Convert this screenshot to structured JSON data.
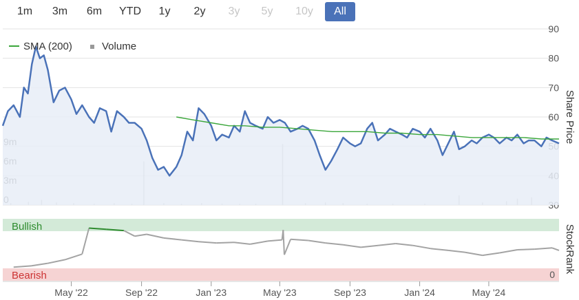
{
  "range_selector": {
    "buttons": [
      {
        "label": "1m",
        "state": "normal"
      },
      {
        "label": "3m",
        "state": "normal"
      },
      {
        "label": "6m",
        "state": "normal"
      },
      {
        "label": "YTD",
        "state": "normal"
      },
      {
        "label": "1y",
        "state": "normal"
      },
      {
        "label": "2y",
        "state": "normal"
      },
      {
        "label": "3y",
        "state": "disabled"
      },
      {
        "label": "5y",
        "state": "disabled"
      },
      {
        "label": "10y",
        "state": "disabled"
      },
      {
        "label": "All",
        "state": "active"
      }
    ]
  },
  "colors": {
    "price": "#4a72b8",
    "sma": "#3aa63a",
    "volume": "#bbbbbb",
    "stockrank": "#a3a3a3",
    "bullish_band": "#d3ead8",
    "bearish_band": "#f6d3d3",
    "bullish_line": "#2e8b2e",
    "bearish_line": "#cc3333",
    "active_button": "#4a72b8"
  },
  "chart_data": [
    {
      "type": "line",
      "legend": [
        "SMA (200)",
        "Volume"
      ],
      "y_label": "Share Price",
      "y_ticks": [
        "90",
        "80",
        "70",
        "60",
        "50",
        "40",
        "30"
      ],
      "y_range": [
        30,
        90
      ],
      "volume_ticks": [
        "9m",
        "6m",
        "3m",
        "0"
      ],
      "volume_range": [
        0,
        12
      ],
      "x_ticks": [
        "May '22",
        "Sep '22",
        "Jan '23",
        "May '23",
        "Sep '23",
        "Jan '24",
        "May '24"
      ],
      "x_range": [
        "2022-01-01",
        "2024-09-01"
      ],
      "series": [
        {
          "name": "Share Price",
          "points": [
            [
              "2022-01-01",
              57
            ],
            [
              "2022-01-10",
              62
            ],
            [
              "2022-01-20",
              64
            ],
            [
              "2022-01-31",
              60
            ],
            [
              "2022-02-07",
              70
            ],
            [
              "2022-02-14",
              68
            ],
            [
              "2022-02-21",
              78
            ],
            [
              "2022-02-28",
              84
            ],
            [
              "2022-03-07",
              80
            ],
            [
              "2022-03-14",
              81
            ],
            [
              "2022-03-21",
              76
            ],
            [
              "2022-03-31",
              65
            ],
            [
              "2022-04-10",
              69
            ],
            [
              "2022-04-20",
              70
            ],
            [
              "2022-05-01",
              66
            ],
            [
              "2022-05-10",
              61
            ],
            [
              "2022-05-20",
              64
            ],
            [
              "2022-06-01",
              60
            ],
            [
              "2022-06-10",
              58
            ],
            [
              "2022-06-20",
              63
            ],
            [
              "2022-07-01",
              62
            ],
            [
              "2022-07-10",
              55
            ],
            [
              "2022-07-20",
              62
            ],
            [
              "2022-08-01",
              60
            ],
            [
              "2022-08-10",
              58
            ],
            [
              "2022-08-20",
              58
            ],
            [
              "2022-09-01",
              56
            ],
            [
              "2022-09-10",
              52
            ],
            [
              "2022-09-20",
              46
            ],
            [
              "2022-09-30",
              42
            ],
            [
              "2022-10-10",
              43
            ],
            [
              "2022-10-20",
              40
            ],
            [
              "2022-11-01",
              43
            ],
            [
              "2022-11-10",
              47
            ],
            [
              "2022-11-20",
              55
            ],
            [
              "2022-11-30",
              52
            ],
            [
              "2022-12-10",
              63
            ],
            [
              "2022-12-20",
              61
            ],
            [
              "2023-01-01",
              57
            ],
            [
              "2023-01-10",
              52
            ],
            [
              "2023-01-20",
              54
            ],
            [
              "2023-02-01",
              53
            ],
            [
              "2023-02-10",
              57
            ],
            [
              "2023-02-20",
              55
            ],
            [
              "2023-03-01",
              62
            ],
            [
              "2023-03-10",
              58
            ],
            [
              "2023-03-20",
              57
            ],
            [
              "2023-04-01",
              56
            ],
            [
              "2023-04-10",
              60
            ],
            [
              "2023-04-20",
              58
            ],
            [
              "2023-05-01",
              59
            ],
            [
              "2023-05-10",
              58
            ],
            [
              "2023-05-20",
              55
            ],
            [
              "2023-06-01",
              56
            ],
            [
              "2023-06-10",
              57
            ],
            [
              "2023-06-20",
              56
            ],
            [
              "2023-07-01",
              52
            ],
            [
              "2023-07-10",
              47
            ],
            [
              "2023-07-20",
              42
            ],
            [
              "2023-07-30",
              45
            ],
            [
              "2023-08-10",
              49
            ],
            [
              "2023-08-20",
              53
            ],
            [
              "2023-09-01",
              51
            ],
            [
              "2023-09-10",
              50
            ],
            [
              "2023-09-20",
              51
            ],
            [
              "2023-10-01",
              56
            ],
            [
              "2023-10-10",
              58
            ],
            [
              "2023-10-20",
              52
            ],
            [
              "2023-11-01",
              54
            ],
            [
              "2023-11-10",
              56
            ],
            [
              "2023-11-20",
              55
            ],
            [
              "2023-12-01",
              54
            ],
            [
              "2023-12-10",
              53
            ],
            [
              "2023-12-20",
              56
            ],
            [
              "2024-01-01",
              55
            ],
            [
              "2024-01-10",
              53
            ],
            [
              "2024-01-20",
              56
            ],
            [
              "2024-02-01",
              52
            ],
            [
              "2024-02-10",
              47
            ],
            [
              "2024-02-20",
              51
            ],
            [
              "2024-03-01",
              55
            ],
            [
              "2024-03-10",
              49
            ],
            [
              "2024-03-20",
              50
            ],
            [
              "2024-04-01",
              52
            ],
            [
              "2024-04-10",
              51
            ],
            [
              "2024-04-20",
              53
            ],
            [
              "2024-05-01",
              54
            ],
            [
              "2024-05-10",
              53
            ],
            [
              "2024-05-20",
              51
            ],
            [
              "2024-06-01",
              53
            ],
            [
              "2024-06-10",
              52
            ],
            [
              "2024-06-20",
              54
            ],
            [
              "2024-07-01",
              51
            ],
            [
              "2024-07-10",
              52
            ],
            [
              "2024-07-20",
              52
            ],
            [
              "2024-08-01",
              50
            ],
            [
              "2024-08-10",
              53
            ],
            [
              "2024-08-20",
              52
            ],
            [
              "2024-09-01",
              51
            ]
          ]
        },
        {
          "name": "SMA (200)",
          "points": [
            [
              "2022-11-01",
              60
            ],
            [
              "2022-12-01",
              59
            ],
            [
              "2023-01-01",
              58
            ],
            [
              "2023-02-01",
              57
            ],
            [
              "2023-03-01",
              57
            ],
            [
              "2023-04-01",
              56.5
            ],
            [
              "2023-05-01",
              56.5
            ],
            [
              "2023-06-01",
              56
            ],
            [
              "2023-07-01",
              55.5
            ],
            [
              "2023-08-01",
              55
            ],
            [
              "2023-09-01",
              55
            ],
            [
              "2023-10-01",
              55
            ],
            [
              "2023-11-01",
              54.5
            ],
            [
              "2023-12-01",
              54.5
            ],
            [
              "2024-01-01",
              54
            ],
            [
              "2024-02-01",
              54
            ],
            [
              "2024-03-01",
              53.5
            ],
            [
              "2024-04-01",
              53
            ],
            [
              "2024-05-01",
              53
            ],
            [
              "2024-06-01",
              53
            ],
            [
              "2024-07-01",
              53
            ],
            [
              "2024-08-01",
              52.5
            ],
            [
              "2024-09-01",
              52.5
            ]
          ]
        },
        {
          "name": "Volume",
          "points": [
            [
              "2022-01-15",
              0.3
            ],
            [
              "2022-02-15",
              0.5
            ],
            [
              "2022-03-10",
              0.8
            ],
            [
              "2022-04-05",
              0.4
            ],
            [
              "2022-05-05",
              0.3
            ],
            [
              "2022-06-10",
              0.2
            ],
            [
              "2022-07-15",
              0.3
            ],
            [
              "2022-08-15",
              0.2
            ],
            [
              "2022-09-05",
              6.8
            ],
            [
              "2022-10-10",
              0.3
            ],
            [
              "2022-11-10",
              0.2
            ],
            [
              "2022-12-15",
              0.3
            ],
            [
              "2023-01-20",
              0.2
            ],
            [
              "2023-02-20",
              0.2
            ],
            [
              "2023-03-20",
              0.2
            ],
            [
              "2023-05-06",
              9.5
            ],
            [
              "2023-06-15",
              0.3
            ],
            [
              "2023-07-20",
              0.4
            ],
            [
              "2023-08-20",
              0.3
            ],
            [
              "2023-10-01",
              0.2
            ],
            [
              "2023-11-15",
              0.2
            ],
            [
              "2024-01-10",
              0.2
            ],
            [
              "2024-03-10",
              1.5
            ],
            [
              "2024-04-20",
              0.4
            ],
            [
              "2024-06-01",
              0.6
            ],
            [
              "2024-06-20",
              1.0
            ],
            [
              "2024-07-15",
              1.2
            ]
          ]
        }
      ]
    },
    {
      "type": "line",
      "y_label": "StockRank",
      "y_ticks": [
        "0"
      ],
      "y_range": [
        0,
        100
      ],
      "bands": [
        {
          "label": "Bullish",
          "from": 80,
          "to": 100
        },
        {
          "label": "Bearish",
          "from": 0,
          "to": 20
        }
      ],
      "series": [
        {
          "name": "StockRank",
          "points": [
            [
              "2022-01-20",
              22
            ],
            [
              "2022-02-20",
              24
            ],
            [
              "2022-03-20",
              28
            ],
            [
              "2022-04-20",
              34
            ],
            [
              "2022-05-20",
              43
            ],
            [
              "2022-06-01",
              85
            ],
            [
              "2022-07-01",
              83
            ],
            [
              "2022-08-01",
              81
            ],
            [
              "2022-08-20",
              72
            ],
            [
              "2022-09-10",
              75
            ],
            [
              "2022-10-10",
              69
            ],
            [
              "2022-11-10",
              66
            ],
            [
              "2022-12-10",
              63
            ],
            [
              "2023-01-10",
              61
            ],
            [
              "2023-02-10",
              62
            ],
            [
              "2023-03-10",
              59
            ],
            [
              "2023-04-10",
              64
            ],
            [
              "2023-05-05",
              66
            ],
            [
              "2023-05-07",
              82
            ],
            [
              "2023-05-09",
              42
            ],
            [
              "2023-05-20",
              67
            ],
            [
              "2023-06-20",
              65
            ],
            [
              "2023-07-20",
              61
            ],
            [
              "2023-08-20",
              58
            ],
            [
              "2023-09-20",
              54
            ],
            [
              "2023-10-20",
              57
            ],
            [
              "2023-11-20",
              60
            ],
            [
              "2023-12-20",
              57
            ],
            [
              "2024-01-20",
              52
            ],
            [
              "2024-02-20",
              49
            ],
            [
              "2024-03-20",
              46
            ],
            [
              "2024-04-20",
              41
            ],
            [
              "2024-05-20",
              45
            ],
            [
              "2024-06-20",
              50
            ],
            [
              "2024-07-20",
              51
            ],
            [
              "2024-08-20",
              53
            ],
            [
              "2024-09-01",
              49
            ]
          ]
        }
      ]
    }
  ]
}
